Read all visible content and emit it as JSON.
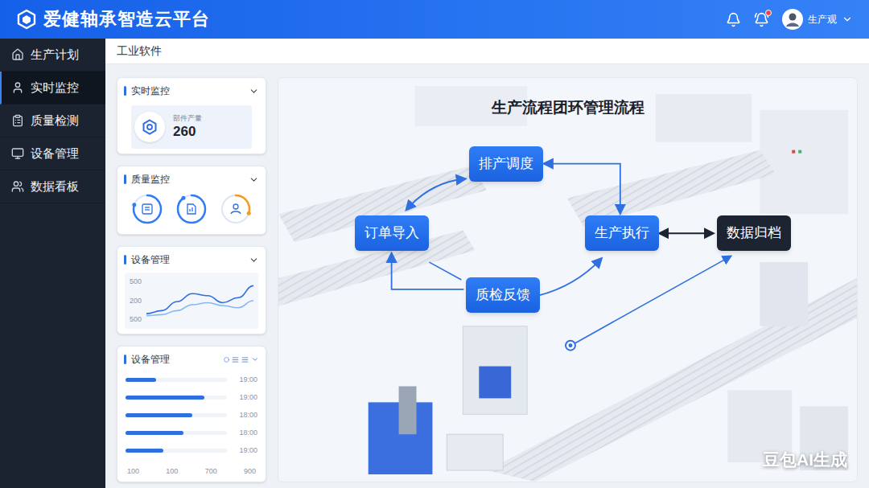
{
  "header": {
    "title": "爱健轴承智造云平台",
    "notifications_unread": true,
    "user": "生产观"
  },
  "sidebar": {
    "items": [
      {
        "label": "生产计划",
        "selected": false
      },
      {
        "label": "实时监控",
        "selected": true
      },
      {
        "label": "质量检测",
        "selected": false
      },
      {
        "label": "设备管理",
        "selected": false
      },
      {
        "label": "数据看板",
        "selected": false
      }
    ]
  },
  "page_title": "工业软件",
  "realtime_card": {
    "title": "实时监控",
    "metric_label": "部件产量",
    "value": "260"
  },
  "quality_card": {
    "title": "质量监控",
    "gauges": [
      {
        "level": 0.8,
        "color": "#2f7df6"
      },
      {
        "level": 0.9,
        "color": "#2f7df6"
      },
      {
        "level": 0.3,
        "color": "#f59a23"
      }
    ]
  },
  "trend_card": {
    "title": "设备管理",
    "y_ticks": [
      "500",
      "200",
      "500"
    ],
    "series": [
      {
        "values": [
          120,
          150,
          240,
          320,
          300,
          230,
          280,
          400
        ],
        "color": "#2f6fe0"
      },
      {
        "values": [
          100,
          110,
          150,
          210,
          230,
          200,
          180,
          250
        ],
        "color": "#8ab6f2"
      }
    ]
  },
  "equipment_card": {
    "title": "设备管理",
    "rows": [
      {
        "level": 0.3,
        "time": "19:00"
      },
      {
        "level": 0.78,
        "time": "19:00"
      },
      {
        "level": 0.66,
        "time": "18:00"
      },
      {
        "level": 0.57,
        "time": "18:00"
      },
      {
        "level": 0.37,
        "time": "19:00"
      }
    ],
    "x_ticks": [
      "100",
      "100",
      "700",
      "900"
    ]
  },
  "diagram": {
    "title": "生产流程团环管理流程",
    "nodes": [
      {
        "label": "排产调度",
        "kind": "primary"
      },
      {
        "label": "订单导入",
        "kind": "primary"
      },
      {
        "label": "生产执行",
        "kind": "primary"
      },
      {
        "label": "数据归档",
        "kind": "archive"
      },
      {
        "label": "质检反馈",
        "kind": "primary"
      }
    ]
  },
  "watermark": "豆包AI生成"
}
